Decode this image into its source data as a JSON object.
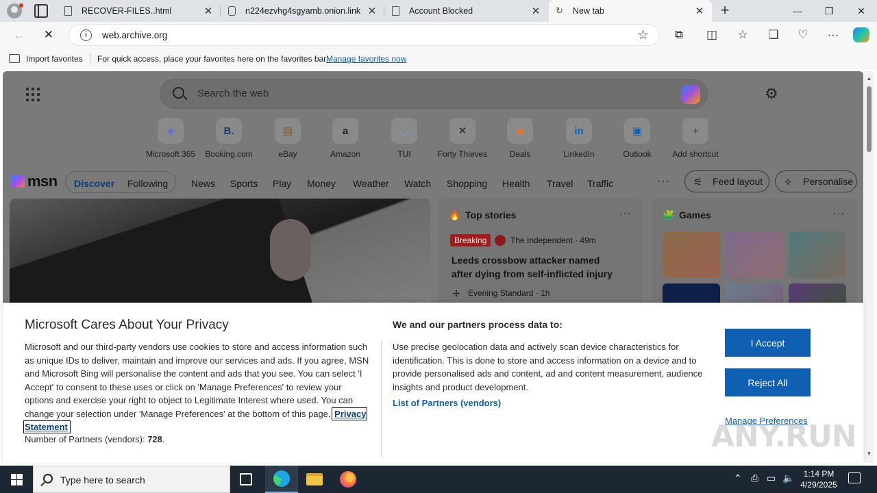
{
  "tabs": [
    {
      "label": "RECOVER-FILES..html",
      "close": "✕"
    },
    {
      "label": "n224ezvhg4sgyamb.onion.link",
      "close": "✕"
    },
    {
      "label": "Account Blocked",
      "close": "✕"
    },
    {
      "label": "New tab",
      "close": "✕"
    }
  ],
  "window_controls": {
    "minimize": "—",
    "restore": "❐",
    "close": "✕"
  },
  "new_tab_label": "+",
  "address_bar": {
    "url": "web.archive.org",
    "stop_glyph": "✕",
    "back_glyph": "←"
  },
  "favorites_bar": {
    "import_label": "Import favorites",
    "hint": "For quick access, place your favorites here on the favorites bar.",
    "manage_link": "Manage favorites now"
  },
  "newtab": {
    "search_placeholder": "Search the web",
    "shortcuts": [
      {
        "label": "Microsoft 365",
        "glyph": "◈",
        "color": "#5b6fd6"
      },
      {
        "label": "Booking.com",
        "glyph": "B.",
        "color": "#1a3a78"
      },
      {
        "label": "eBay",
        "glyph": "▤",
        "color": "#7a5a2a"
      },
      {
        "label": "Amazon",
        "glyph": "a",
        "color": "#222222"
      },
      {
        "label": "TUI",
        "glyph": "◡",
        "color": "#5fa7e0"
      },
      {
        "label": "Forty Thieves",
        "glyph": "✕",
        "color": "#222222"
      },
      {
        "label": "Deals",
        "glyph": "◆",
        "color": "#d9782a"
      },
      {
        "label": "LinkedIn",
        "glyph": "in",
        "color": "#0a66c2"
      },
      {
        "label": "Outlook",
        "glyph": "▣",
        "color": "#0f5fb3"
      },
      {
        "label": "Add shortcut",
        "glyph": "+",
        "color": "#555555"
      }
    ]
  },
  "msn": {
    "logo": "msn",
    "tabs": {
      "discover": "Discover",
      "following": "Following"
    },
    "nav": [
      "News",
      "Sports",
      "Play",
      "Money",
      "Weather",
      "Watch",
      "Shopping",
      "Health",
      "Travel",
      "Traffic"
    ],
    "more": "···",
    "feed_layout": "Feed layout",
    "personalise": "Personalise"
  },
  "top_stories": {
    "title": "Top stories",
    "more": "···",
    "badge": "Breaking",
    "source": "The Independent · 49m",
    "headline": "Leeds crossbow attacker named after dying from self-inflicted injury",
    "source2": "Evening Standard · 1h"
  },
  "games": {
    "title": "Games",
    "more": "···"
  },
  "privacy": {
    "title": "Microsoft Cares About Your Privacy",
    "body": "Microsoft and our third-party vendors use cookies to store and access information such as unique IDs to deliver, maintain and improve our services and ads. If you agree, MSN and Microsoft Bing will personalise the content and ads that you see. You can select 'I Accept' to consent to these uses or click on 'Manage Preferences' to review your options and exercise your right to object to Legitimate Interest where used.  You can change your selection under 'Manage Preferences' at the bottom of this page.",
    "privacy_link": "Privacy Statement",
    "partners_label": "Number of Partners (vendors):",
    "partners_count": "728",
    "heading2": "We and our partners process data to:",
    "body2": "Use precise geolocation data and actively scan device characteristics for identification. This is done to store and access information on a device and to provide personalised ads and content, ad and content measurement, audience insights and product development.",
    "list_link": "List of Partners (vendors)",
    "accept": "I Accept",
    "reject": "Reject All",
    "manage": "Manage Preferences"
  },
  "taskbar": {
    "search_placeholder": "Type here to search",
    "time": "1:14 PM",
    "date": "4/29/2025"
  },
  "watermark": "ANY.RUN"
}
